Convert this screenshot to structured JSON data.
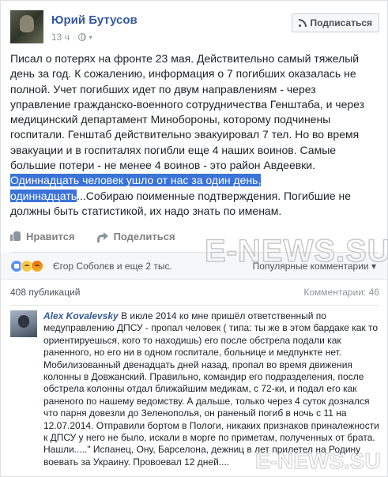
{
  "post": {
    "author": "Юрий Бутусов",
    "time": "13 ч",
    "subscribe_label": "Подписаться",
    "text_part1": "Писал о потерях на фронте 23 мая. Действительно самый тяжелый день за год. К сожалению, информация о 7 погибших оказалась не полной. Учет погибших идет по двум направлениям - через управление гражданско-военного сотрудничества Генштаба, и через медицинский департамент Минобороны, которому подчинены госпитали. Генштаб действительно эвакуировал 7 тел. Но во время эвакуации и в госпиталях погибли еще 4 наших воинов. Самые большие потери - не менее 4 воинов - это район Авдеевки.",
    "text_highlight1": "Одиннадцать человек ушло от нас за один день,",
    "text_highlight2": "одиннадцать",
    "text_part2": "...Собираю поименные подтверждения. Погибшие не должны быть статистикой, их надо знать по именам."
  },
  "actions": {
    "like_label": "Нравится",
    "share_label": "Поделиться"
  },
  "reactions": {
    "names": "Єгор Соболєв и еще 2 тыс.",
    "popular_label": "Популярные комментарии"
  },
  "counts": {
    "shares": "408 публикаций",
    "comments": "Комментарии: 46"
  },
  "comment": {
    "author": "Alex Kovalevsky",
    "text": "В июле 2014 ко мне пришёл ответственный по медуправлению ДПСУ - пропал человек ( типа: ты же в этом бардаке как то ориентируешься, кого то находишь) его после обстрела подали как раненного, но его ни в одном госпитале, больнице и медпункте нет. Мобилизованный двенадцать дней назад, пропал во время движения колонны в Довжанский. Правильно, командир его подразделения, после обстрела колонны отдал ближайшим медикам, с 72-ки, и подал его как раненого по нашему ведомству. А дальше, только через 4 суток дознался что парня довезли до Зеленополья, он раненый погиб в ночь с 11 на 12.07.2014. Отправили бортом в Пологи, никаких признаков приналежности к ДПСУ у него не было, искали в морге по приметам, полученных от брата. Нашли.....\" Испанец, Ону, Барселона, дежниц в лет прилетел на Родину воевать за Украину. Провоевал 12 дней...."
  },
  "watermark": {
    "text": "E-NEWS.SU"
  }
}
